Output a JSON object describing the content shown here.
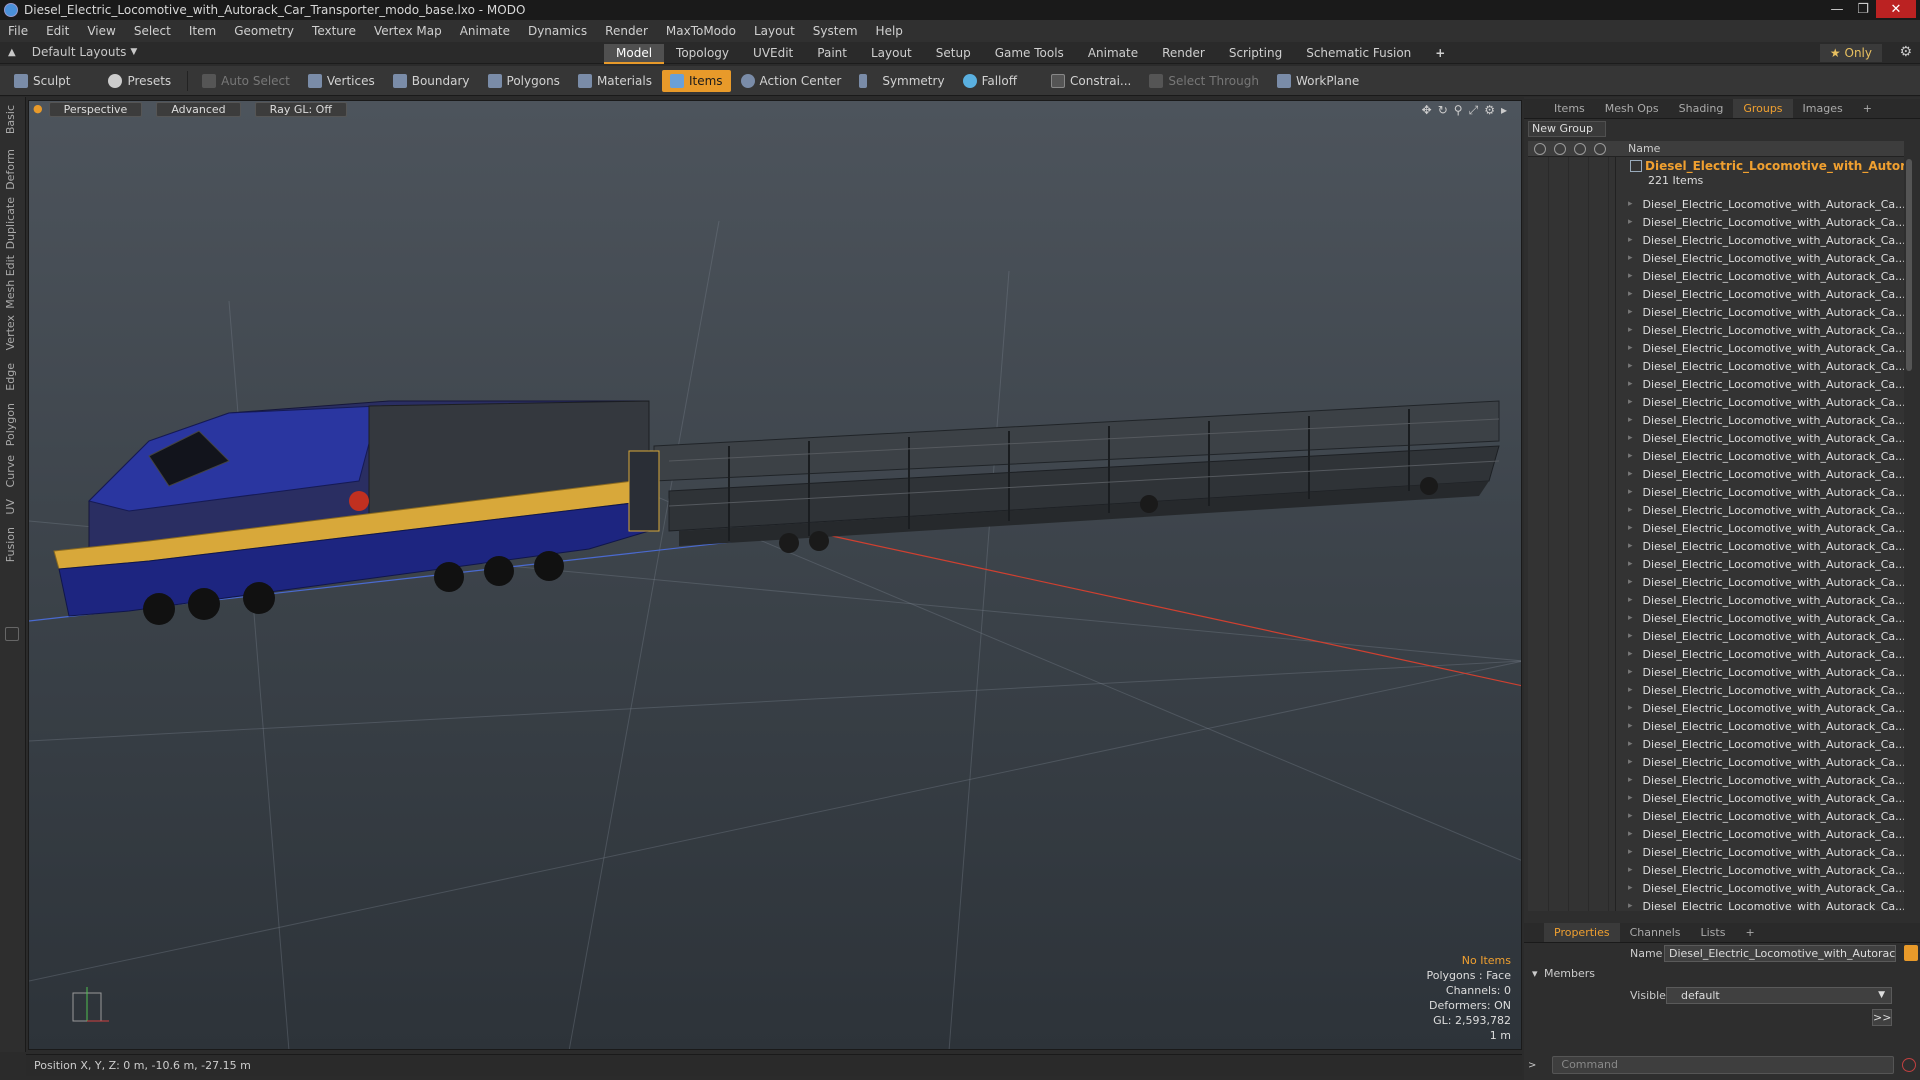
{
  "window": {
    "title": "Diesel_Electric_Locomotive_with_Autorack_Car_Transporter_modo_base.lxo - MODO"
  },
  "menu": [
    "File",
    "Edit",
    "View",
    "Select",
    "Item",
    "Geometry",
    "Texture",
    "Vertex Map",
    "Animate",
    "Dynamics",
    "Render",
    "MaxToModo",
    "Layout",
    "System",
    "Help"
  ],
  "layout": {
    "selector": "Default Layouts",
    "tabs": [
      "Model",
      "Topology",
      "UVEdit",
      "Paint",
      "Layout",
      "Setup",
      "Game Tools",
      "Animate",
      "Render",
      "Scripting",
      "Schematic Fusion"
    ],
    "active_tab": "Model",
    "only_label": "Only"
  },
  "toolbar": {
    "sculpt": "Sculpt",
    "presets": "Presets",
    "auto_select": "Auto Select",
    "vertices": "Vertices",
    "boundary": "Boundary",
    "polygons": "Polygons",
    "materials": "Materials",
    "items": "Items",
    "action_center": "Action Center",
    "symmetry": "Symmetry",
    "falloff": "Falloff",
    "constraints": "Constrai...",
    "select_through": "Select Through",
    "workplane": "WorkPlane"
  },
  "left_tabs": [
    "Basic",
    "Deform",
    "Duplicate",
    "Mesh Edit",
    "Vertex",
    "Edge",
    "Polygon",
    "Curve",
    "UV",
    "Fusion"
  ],
  "viewport": {
    "view_mode": "Perspective",
    "shading": "Advanced",
    "raygl": "Ray GL: Off",
    "stats": {
      "selection": "No Items",
      "polygons": "Polygons : Face",
      "channels": "Channels: 0",
      "deformers": "Deformers: ON",
      "gl": "GL: 2,593,782",
      "scale": "1 m"
    }
  },
  "statusbar": {
    "position": "Position X, Y, Z:  0 m, -10.6 m, -27.15 m"
  },
  "groups_panel": {
    "tabs": [
      "Items",
      "Mesh Ops",
      "Shading",
      "Groups",
      "Images"
    ],
    "active_tab": "Groups",
    "new_group": "New Group",
    "name_header": "Name",
    "group_name": "Diesel_Electric_Locomotive_with_Autora ...",
    "group_count": "221 Items",
    "item_label": "Diesel_Electric_Locomotive_with_Autorack_Ca..."
  },
  "properties_panel": {
    "tabs": [
      "Properties",
      "Channels",
      "Lists"
    ],
    "active_tab": "Properties",
    "name_label": "Name",
    "name_value": "Diesel_Electric_Locomotive_with_Autorack_C",
    "members_label": "Members",
    "visible_label": "Visible",
    "visible_value": "default",
    "command_placeholder": "Command"
  },
  "colors": {
    "accent": "#e89a2a",
    "locomotive_blue": "#1f2a8a",
    "locomotive_yellow": "#d8a83a"
  }
}
